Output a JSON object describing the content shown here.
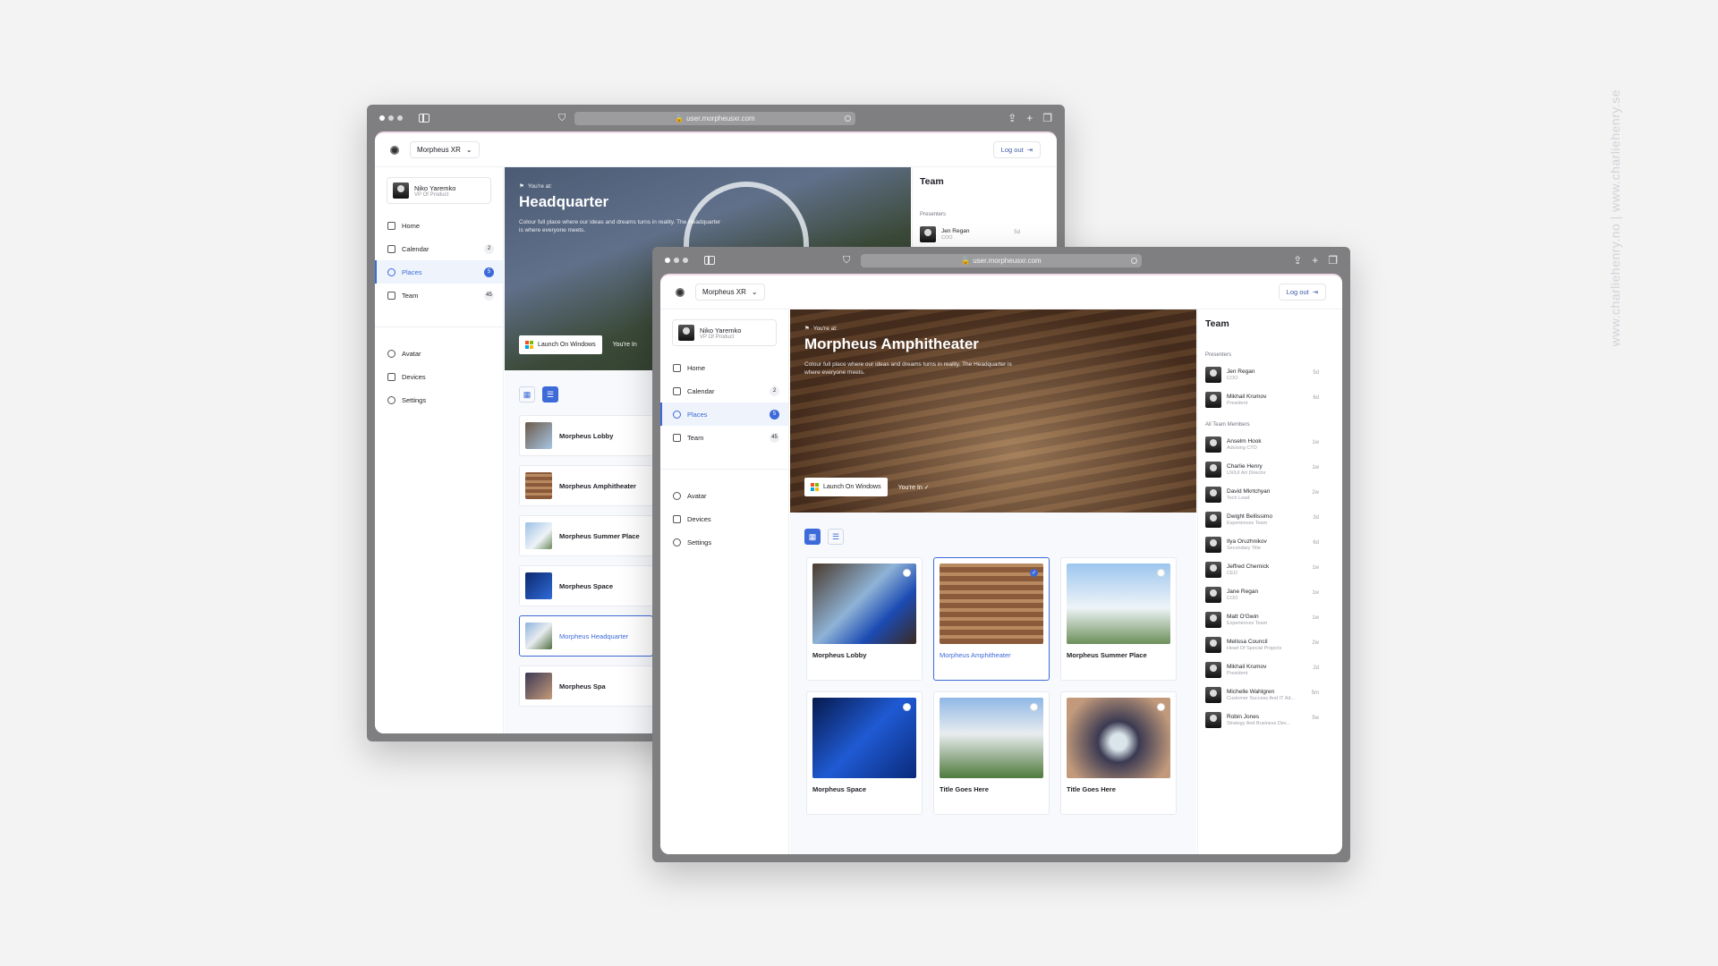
{
  "browser": {
    "url": "user.morpheusxr.com"
  },
  "org_selector": {
    "label": "Morpheus XR"
  },
  "logout": {
    "label": "Log out"
  },
  "user": {
    "name": "Niko Yaremko",
    "role": "VP Of Product"
  },
  "nav": {
    "items": [
      {
        "label": "Home",
        "icon": "home-icon"
      },
      {
        "label": "Calendar",
        "icon": "calendar-icon",
        "badge": "2"
      },
      {
        "label": "Places",
        "icon": "places-icon",
        "badge": "5",
        "active": true
      },
      {
        "label": "Team",
        "icon": "team-icon",
        "badge": "45"
      }
    ],
    "secondary": [
      {
        "label": "Avatar",
        "icon": "avatar-icon"
      },
      {
        "label": "Devices",
        "icon": "devices-icon"
      },
      {
        "label": "Settings",
        "icon": "settings-icon"
      }
    ]
  },
  "hero_back": {
    "you_are_at": "You're at:",
    "title": "Headquarter",
    "description": "Colour full place where our ideas and dreams turns in reality. The Headquarter is where everyone meets.",
    "launch": "Launch On Windows",
    "you_in": "You're In"
  },
  "hero_front": {
    "you_are_at": "You're at:",
    "title": "Morpheus Amphitheater",
    "description": "Colour full place where our ideas and dreams turns in reality. The Headquarter is where everyone meets.",
    "launch": "Launch On Windows",
    "you_in": "You're In"
  },
  "places_list": [
    {
      "name": "Morpheus Lobby"
    },
    {
      "name": "Morpheus Amphitheater"
    },
    {
      "name": "Morpheus Summer Place"
    },
    {
      "name": "Morpheus Space"
    },
    {
      "name": "Morpheus Headquarter",
      "selected": true
    },
    {
      "name": "Morpheus Spa"
    }
  ],
  "places_grid": [
    {
      "name": "Morpheus Lobby"
    },
    {
      "name": "Morpheus Amphitheater",
      "selected": true
    },
    {
      "name": "Morpheus Summer Place"
    },
    {
      "name": "Morpheus Space"
    },
    {
      "name": "Title Goes Here"
    },
    {
      "name": "Title Goes Here"
    }
  ],
  "team": {
    "title": "Team",
    "presenters_label": "Presenters",
    "presenters": [
      {
        "name": "Jen Regan",
        "role": "COO",
        "time": "5d"
      },
      {
        "name": "Mikhail Krumov",
        "role": "President",
        "time": "6d"
      }
    ],
    "all_label": "All Team Members",
    "members": [
      {
        "name": "Anselm Hook",
        "role": "Advising CTO",
        "time": "1w"
      },
      {
        "name": "Charlie Henry",
        "role": "UX/UI Art Director",
        "time": "1w"
      },
      {
        "name": "David Mkrtchyan",
        "role": "Tech Lead",
        "time": "2w"
      },
      {
        "name": "Dwight Bellissimo",
        "role": "Experiences Team",
        "time": "3d"
      },
      {
        "name": "Ilya Oruzhnikov",
        "role": "Secondary Title",
        "time": "6d"
      },
      {
        "name": "Jeffred Chernick",
        "role": "CEO",
        "time": "1w"
      },
      {
        "name": "Jane Regan",
        "role": "COO",
        "time": "1w"
      },
      {
        "name": "Matt O'Gwin",
        "role": "Experiences Team",
        "time": "1w"
      },
      {
        "name": "Melissa Council",
        "role": "Head Of Special Projects",
        "time": "2w"
      },
      {
        "name": "Mikhail Krumov",
        "role": "President",
        "time": "2d"
      },
      {
        "name": "Michelle Wahlgren",
        "role": "Customer Success And IT Ad...",
        "time": "5m"
      },
      {
        "name": "Robin Jones",
        "role": "Strategy And Business Dev...",
        "time": "5w"
      }
    ]
  },
  "watermark": "www.charliehenry.no | www.charliehenry.se",
  "colors": {
    "accent": "#3d6ad9",
    "chrome": "#7f7f81",
    "background": "#f3f3f4"
  }
}
